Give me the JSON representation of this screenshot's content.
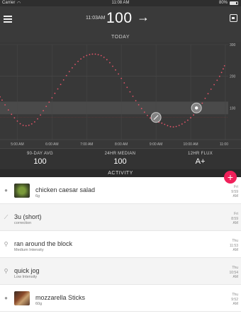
{
  "status_bar": {
    "carrier": "Carrier",
    "time": "11:08 AM",
    "battery": "80%",
    "battery_level": 0.8
  },
  "header": {
    "time": "11:03AM",
    "value": "100",
    "arrow": "→"
  },
  "chart_title": "TODAY",
  "chart_data": {
    "type": "scatter",
    "x_ticks": [
      "5:00 AM",
      "6:00 AM",
      "7:00 AM",
      "8:00 AM",
      "9:00 AM",
      "10:00 AM",
      "11:00"
    ],
    "y_ticks": [
      "300",
      "200",
      "100"
    ],
    "ylim": [
      0,
      300
    ],
    "target_range": [
      80,
      120
    ],
    "low_line": 70,
    "high_line": 180,
    "series": [
      {
        "x": [
          "4:30",
          "4:50",
          "5:10",
          "5:30",
          "5:50",
          "6:10",
          "6:30",
          "6:50",
          "7:10",
          "7:30",
          "7:50",
          "8:10",
          "8:30",
          "8:50",
          "9:10",
          "9:30",
          "9:50",
          "10:10",
          "10:30",
          "10:50",
          "11:00"
        ],
        "y": [
          135,
          80,
          45,
          56,
          105,
          160,
          215,
          255,
          270,
          260,
          220,
          165,
          110,
          68,
          52,
          40,
          55,
          88,
          145,
          200,
          240
        ]
      }
    ],
    "event_markers": [
      {
        "time": "9:00",
        "value": 70,
        "icon": "syringe-icon"
      },
      {
        "time": "10:10",
        "value": 100,
        "icon": "food-icon"
      }
    ],
    "grid": true
  },
  "stats": [
    {
      "label": "90-DAY AVG",
      "value": "100"
    },
    {
      "label": "24HR MEDIAN",
      "value": "100"
    },
    {
      "label": "12HR FLUX",
      "value": "A+"
    }
  ],
  "activity_label": "ACTIVITY",
  "add_button": "+",
  "activities": [
    {
      "title": "chicken caesar salad",
      "sub": "6g",
      "day": "Fri",
      "time": "9:59",
      "ampm": "AM",
      "icon": "apple-icon",
      "thumb": true
    },
    {
      "title": "3u (short)",
      "sub": "correction",
      "day": "Fri",
      "time": "8:59",
      "ampm": "AM",
      "icon": "syringe-icon",
      "thumb": false
    },
    {
      "title": "ran around the block",
      "sub": "Medium Intensity",
      "day": "Thu",
      "time": "11:53",
      "ampm": "AM",
      "icon": "runner-icon",
      "thumb": false
    },
    {
      "title": "quick jog",
      "sub": "Low Intensity",
      "day": "Thu",
      "time": "10:54",
      "ampm": "AM",
      "icon": "runner-icon",
      "thumb": false
    },
    {
      "title": "mozzarella Sticks",
      "sub": "60g",
      "day": "Thu",
      "time": "9:52",
      "ampm": "AM",
      "icon": "apple-icon",
      "thumb": true
    }
  ]
}
